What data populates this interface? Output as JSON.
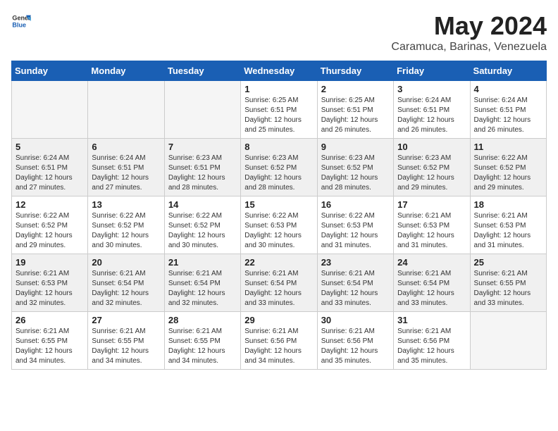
{
  "header": {
    "logo_general": "General",
    "logo_blue": "Blue",
    "month_year": "May 2024",
    "location": "Caramuca, Barinas, Venezuela"
  },
  "weekdays": [
    "Sunday",
    "Monday",
    "Tuesday",
    "Wednesday",
    "Thursday",
    "Friday",
    "Saturday"
  ],
  "weeks": [
    [
      {
        "day": "",
        "info": ""
      },
      {
        "day": "",
        "info": ""
      },
      {
        "day": "",
        "info": ""
      },
      {
        "day": "1",
        "info": "Sunrise: 6:25 AM\nSunset: 6:51 PM\nDaylight: 12 hours\nand 25 minutes."
      },
      {
        "day": "2",
        "info": "Sunrise: 6:25 AM\nSunset: 6:51 PM\nDaylight: 12 hours\nand 26 minutes."
      },
      {
        "day": "3",
        "info": "Sunrise: 6:24 AM\nSunset: 6:51 PM\nDaylight: 12 hours\nand 26 minutes."
      },
      {
        "day": "4",
        "info": "Sunrise: 6:24 AM\nSunset: 6:51 PM\nDaylight: 12 hours\nand 26 minutes."
      }
    ],
    [
      {
        "day": "5",
        "info": "Sunrise: 6:24 AM\nSunset: 6:51 PM\nDaylight: 12 hours\nand 27 minutes."
      },
      {
        "day": "6",
        "info": "Sunrise: 6:24 AM\nSunset: 6:51 PM\nDaylight: 12 hours\nand 27 minutes."
      },
      {
        "day": "7",
        "info": "Sunrise: 6:23 AM\nSunset: 6:51 PM\nDaylight: 12 hours\nand 28 minutes."
      },
      {
        "day": "8",
        "info": "Sunrise: 6:23 AM\nSunset: 6:52 PM\nDaylight: 12 hours\nand 28 minutes."
      },
      {
        "day": "9",
        "info": "Sunrise: 6:23 AM\nSunset: 6:52 PM\nDaylight: 12 hours\nand 28 minutes."
      },
      {
        "day": "10",
        "info": "Sunrise: 6:23 AM\nSunset: 6:52 PM\nDaylight: 12 hours\nand 29 minutes."
      },
      {
        "day": "11",
        "info": "Sunrise: 6:22 AM\nSunset: 6:52 PM\nDaylight: 12 hours\nand 29 minutes."
      }
    ],
    [
      {
        "day": "12",
        "info": "Sunrise: 6:22 AM\nSunset: 6:52 PM\nDaylight: 12 hours\nand 29 minutes."
      },
      {
        "day": "13",
        "info": "Sunrise: 6:22 AM\nSunset: 6:52 PM\nDaylight: 12 hours\nand 30 minutes."
      },
      {
        "day": "14",
        "info": "Sunrise: 6:22 AM\nSunset: 6:52 PM\nDaylight: 12 hours\nand 30 minutes."
      },
      {
        "day": "15",
        "info": "Sunrise: 6:22 AM\nSunset: 6:53 PM\nDaylight: 12 hours\nand 30 minutes."
      },
      {
        "day": "16",
        "info": "Sunrise: 6:22 AM\nSunset: 6:53 PM\nDaylight: 12 hours\nand 31 minutes."
      },
      {
        "day": "17",
        "info": "Sunrise: 6:21 AM\nSunset: 6:53 PM\nDaylight: 12 hours\nand 31 minutes."
      },
      {
        "day": "18",
        "info": "Sunrise: 6:21 AM\nSunset: 6:53 PM\nDaylight: 12 hours\nand 31 minutes."
      }
    ],
    [
      {
        "day": "19",
        "info": "Sunrise: 6:21 AM\nSunset: 6:53 PM\nDaylight: 12 hours\nand 32 minutes."
      },
      {
        "day": "20",
        "info": "Sunrise: 6:21 AM\nSunset: 6:54 PM\nDaylight: 12 hours\nand 32 minutes."
      },
      {
        "day": "21",
        "info": "Sunrise: 6:21 AM\nSunset: 6:54 PM\nDaylight: 12 hours\nand 32 minutes."
      },
      {
        "day": "22",
        "info": "Sunrise: 6:21 AM\nSunset: 6:54 PM\nDaylight: 12 hours\nand 33 minutes."
      },
      {
        "day": "23",
        "info": "Sunrise: 6:21 AM\nSunset: 6:54 PM\nDaylight: 12 hours\nand 33 minutes."
      },
      {
        "day": "24",
        "info": "Sunrise: 6:21 AM\nSunset: 6:54 PM\nDaylight: 12 hours\nand 33 minutes."
      },
      {
        "day": "25",
        "info": "Sunrise: 6:21 AM\nSunset: 6:55 PM\nDaylight: 12 hours\nand 33 minutes."
      }
    ],
    [
      {
        "day": "26",
        "info": "Sunrise: 6:21 AM\nSunset: 6:55 PM\nDaylight: 12 hours\nand 34 minutes."
      },
      {
        "day": "27",
        "info": "Sunrise: 6:21 AM\nSunset: 6:55 PM\nDaylight: 12 hours\nand 34 minutes."
      },
      {
        "day": "28",
        "info": "Sunrise: 6:21 AM\nSunset: 6:55 PM\nDaylight: 12 hours\nand 34 minutes."
      },
      {
        "day": "29",
        "info": "Sunrise: 6:21 AM\nSunset: 6:56 PM\nDaylight: 12 hours\nand 34 minutes."
      },
      {
        "day": "30",
        "info": "Sunrise: 6:21 AM\nSunset: 6:56 PM\nDaylight: 12 hours\nand 35 minutes."
      },
      {
        "day": "31",
        "info": "Sunrise: 6:21 AM\nSunset: 6:56 PM\nDaylight: 12 hours\nand 35 minutes."
      },
      {
        "day": "",
        "info": ""
      }
    ]
  ]
}
